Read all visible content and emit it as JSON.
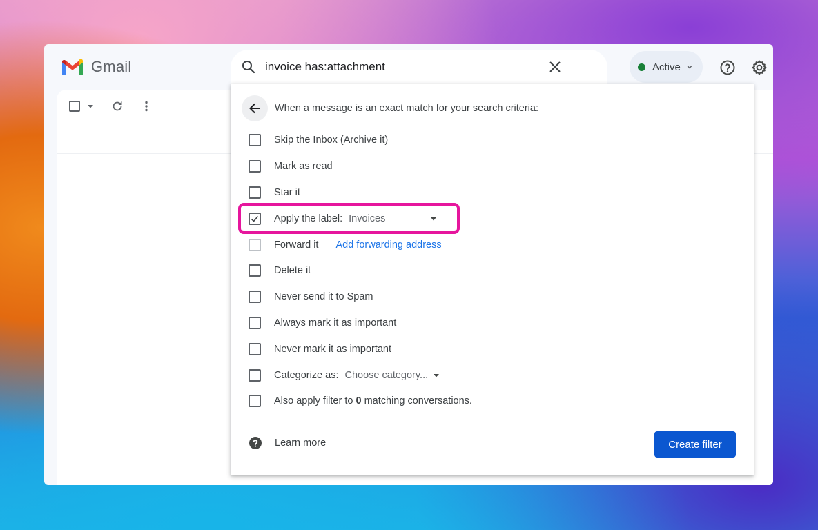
{
  "app": {
    "name": "Gmail"
  },
  "search": {
    "query": "invoice has:attachment"
  },
  "status": {
    "label": "Active",
    "dot_color": "#188038"
  },
  "filter_panel": {
    "heading": "When a message is an exact match for your search criteria:",
    "options": [
      {
        "label": "Skip the Inbox (Archive it)",
        "checked": false
      },
      {
        "label": "Mark as read",
        "checked": false
      },
      {
        "label": "Star it",
        "checked": false
      },
      {
        "label": "Apply the label:",
        "checked": true,
        "select_value": "Invoices"
      },
      {
        "label": "Forward it",
        "checked": false,
        "disabled": true,
        "link": "Add forwarding address"
      },
      {
        "label": "Delete it",
        "checked": false
      },
      {
        "label": "Never send it to Spam",
        "checked": false
      },
      {
        "label": "Always mark it as important",
        "checked": false
      },
      {
        "label": "Never mark it as important",
        "checked": false
      },
      {
        "label": "Categorize as:",
        "checked": false,
        "select_value": "Choose category..."
      },
      {
        "label_prefix": "Also apply filter to ",
        "count": "0",
        "label_suffix": " matching conversations.",
        "checked": false
      }
    ],
    "learn_more": "Learn more",
    "create_button": "Create filter"
  },
  "colors": {
    "accent": "#0b57d0",
    "highlight": "#e6169d",
    "link": "#1a73e8"
  }
}
